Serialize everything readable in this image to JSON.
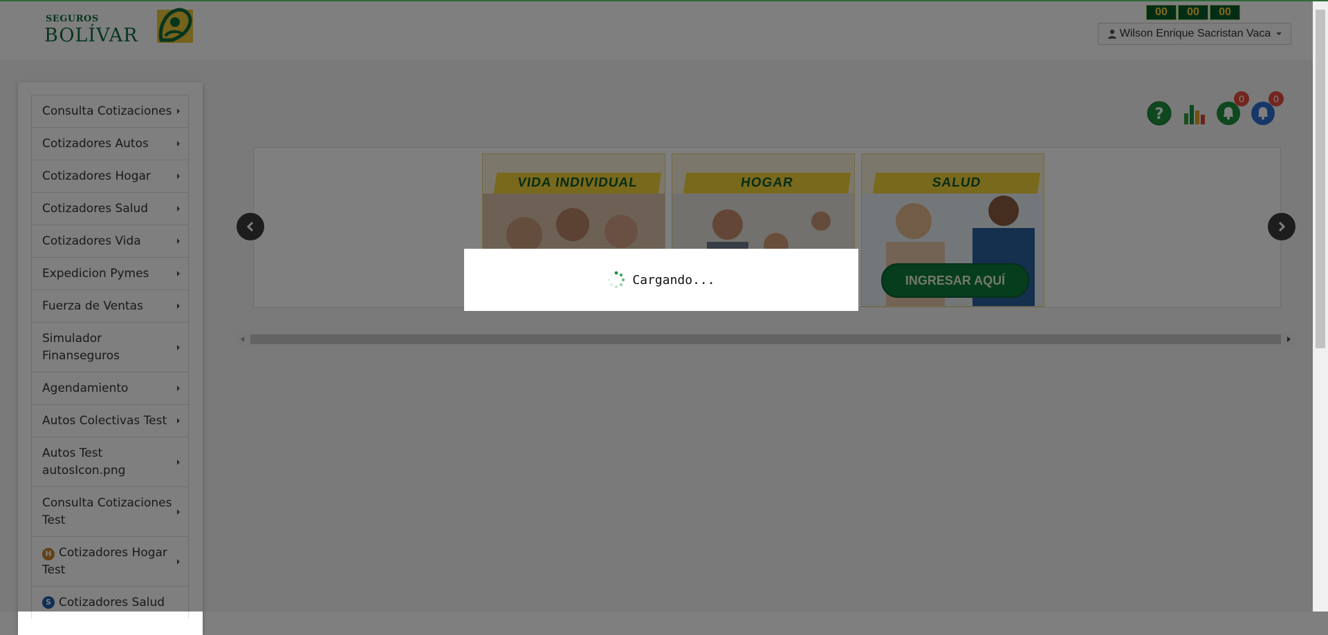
{
  "brand": {
    "name_small": "SEGUROS",
    "name_big": "BOLÍVAR"
  },
  "header": {
    "timer": [
      "00",
      "00",
      "00"
    ],
    "user_name": "Wilson Enrique Sacristan Vaca"
  },
  "sidebar": {
    "items": [
      {
        "label": "Consulta Cotizaciones"
      },
      {
        "label": "Cotizadores Autos"
      },
      {
        "label": "Cotizadores Hogar"
      },
      {
        "label": "Cotizadores Salud"
      },
      {
        "label": "Cotizadores Vida"
      },
      {
        "label": "Expedicion Pymes"
      },
      {
        "label": "Fuerza de Ventas"
      },
      {
        "label": "Simulador Finanseguros"
      },
      {
        "label": "Agendamiento"
      },
      {
        "label": "Autos Colectivas Test"
      },
      {
        "label": "Autos Test autosIcon.png"
      },
      {
        "label": "Consulta Cotizaciones Test"
      },
      {
        "label": "Cotizadores Hogar Test",
        "badge": "H"
      },
      {
        "label": "Cotizadores Salud",
        "badge": "S"
      }
    ]
  },
  "toolbar": {
    "help_icon": "question-icon",
    "stats_icon": "bar-chart-icon",
    "notifications_green_count": "0",
    "notifications_blue_count": "0"
  },
  "carousel": {
    "banners": [
      {
        "title": "VIDA INDIVIDUAL"
      },
      {
        "title": "HOGAR"
      },
      {
        "title": "SALUD",
        "cta": "INGRESAR AQUÍ"
      }
    ]
  },
  "loading": {
    "text": "Cargando..."
  },
  "colors": {
    "brand_green": "#0d6b3b",
    "accent_yellow": "#f3d33a",
    "alert_red": "#e74c3c"
  }
}
